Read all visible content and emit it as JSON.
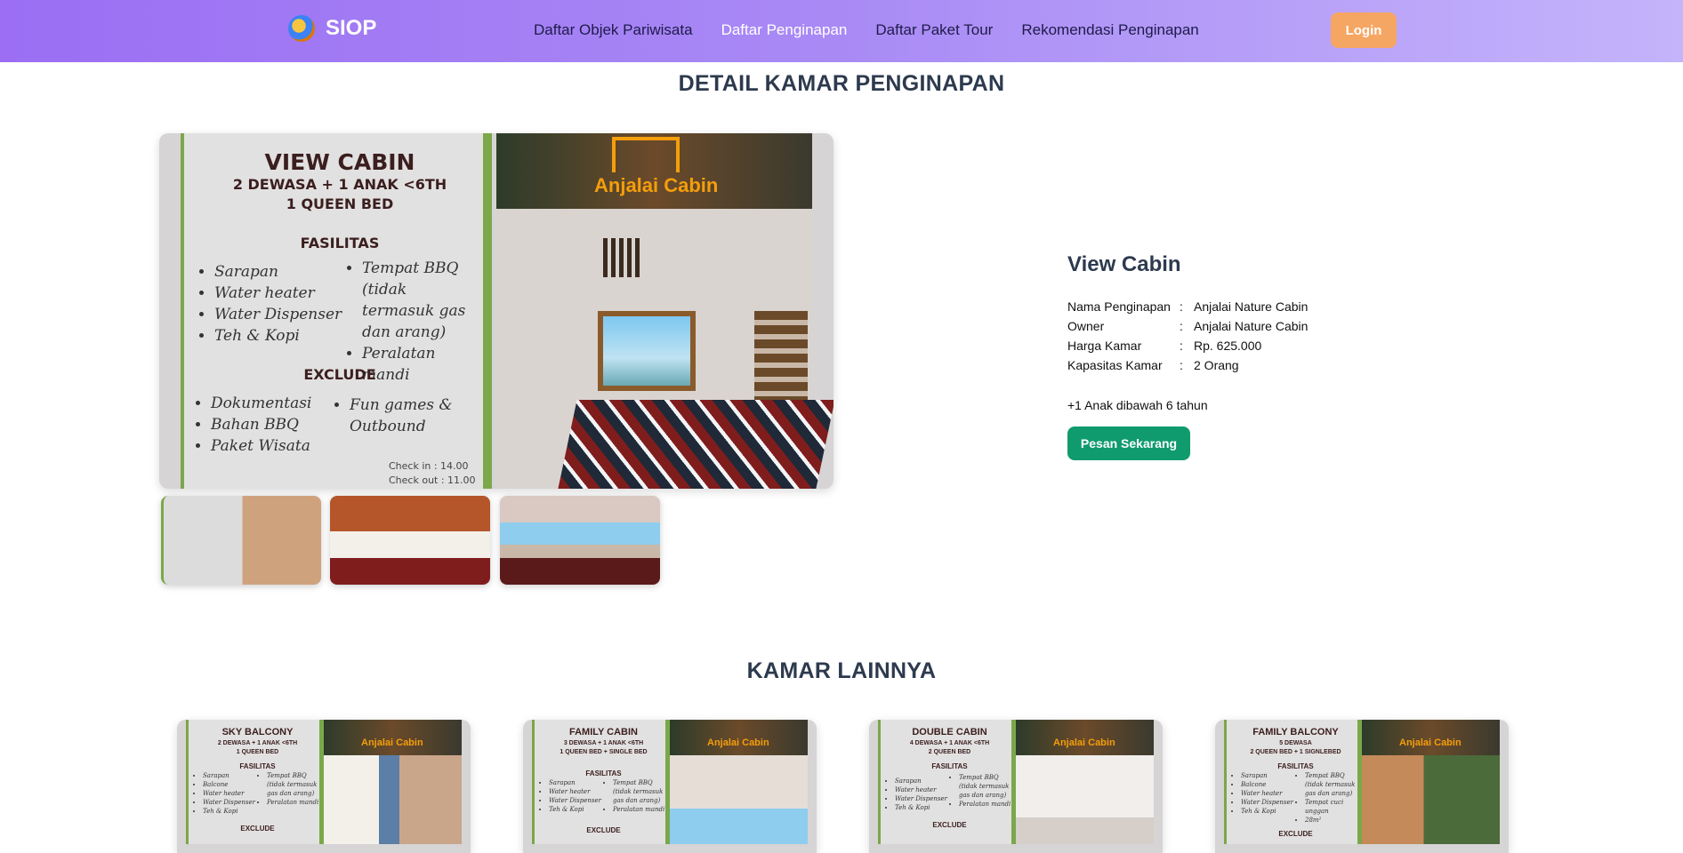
{
  "navbar": {
    "brand": "SIOP",
    "links": [
      {
        "label": "Daftar Objek Pariwisata",
        "active": false
      },
      {
        "label": "Daftar Penginapan",
        "active": true
      },
      {
        "label": "Daftar Paket Tour",
        "active": false
      },
      {
        "label": "Rekomendasi Penginapan",
        "active": false
      }
    ],
    "login_label": "Login"
  },
  "detail_heading": "DETAIL KAMAR PENGINAPAN",
  "poster": {
    "title": "VIEW CABIN",
    "subtitle_1": "2 DEWASA + 1 ANAK <6TH",
    "subtitle_2": "1 QUEEN BED",
    "fasilitas_label": "FASILITAS",
    "fasilitas_left": [
      "Sarapan",
      "Water heater",
      "Water Dispenser",
      "Teh & Kopi"
    ],
    "fasilitas_right": [
      "Tempat BBQ (tidak termasuk gas dan arang)",
      "Peralatan mandi"
    ],
    "exclude_label": "EXCLUDE",
    "exclude_left": [
      "Dokumentasi",
      "Bahan BBQ",
      "Paket Wisata"
    ],
    "exclude_right": [
      "Fun games & Outbound"
    ],
    "check_in": "Check in   : 14.00",
    "check_out": "Check out : 11.00",
    "brand": "Anjalai Cabin"
  },
  "room": {
    "name": "View Cabin",
    "info": [
      {
        "label": "Nama Penginapan",
        "value": "Anjalai Nature Cabin"
      },
      {
        "label": "Owner",
        "value": "Anjalai Nature Cabin"
      },
      {
        "label": "Harga Kamar",
        "value": "Rp. 625.000"
      },
      {
        "label": "Kapasitas Kamar",
        "value": "2 Orang"
      }
    ],
    "separator": ":",
    "extra": "+1 Anak dibawah 6 tahun",
    "order_label": "Pesan Sekarang"
  },
  "other_heading": "KAMAR LAINNYA",
  "other_rooms": [
    {
      "title": "SKY BALCONY",
      "sub1": "2 DEWASA + 1 ANAK <6TH",
      "sub2": "1 QUEEN BED",
      "left": [
        "Sarapan",
        "Balcone",
        "Water heater",
        "Water Dispenser",
        "Teh & Kopi"
      ],
      "right": [
        "Tempat BBQ (tidak termasuk gas dan arang)",
        "Peralatan mandi"
      ]
    },
    {
      "title": "FAMILY CABIN",
      "sub1": "3 DEWASA + 1 ANAK <6TH",
      "sub2": "1 QUEEN BED + SINGLE BED",
      "left": [
        "Sarapan",
        "Water heater",
        "Water Dispenser",
        "Teh & Kopi"
      ],
      "right": [
        "Tempat BBQ (tidak termasuk gas dan arang)",
        "Peralatan mandi"
      ]
    },
    {
      "title": "DOUBLE CABIN",
      "sub1": "4 DEWASA + 1 ANAK <6TH",
      "sub2": "2 QUEEN BED",
      "left": [
        "Sarapan",
        "Water heater",
        "Water Dispenser",
        "Teh & Kopi"
      ],
      "right": [
        "Tempat BBQ (tidak termasuk gas dan arang)",
        "Peralatan mandi"
      ]
    },
    {
      "title": "FAMILY BALCONY",
      "sub1": "5 DEWASA",
      "sub2": "2 QUEEN BED + 1 SIGNLEBED",
      "left": [
        "Sarapan",
        "Balcone",
        "Water heater",
        "Water Dispenser",
        "Teh & Kopi"
      ],
      "right": [
        "Tempat BBQ (tidak termasuk gas dan arang)",
        "Tempat cuci unggan",
        "28m²"
      ]
    }
  ],
  "other_labels": {
    "fasilitas": "FASILITAS",
    "exclude": "EXCLUDE",
    "brand": "Anjalai Cabin"
  }
}
